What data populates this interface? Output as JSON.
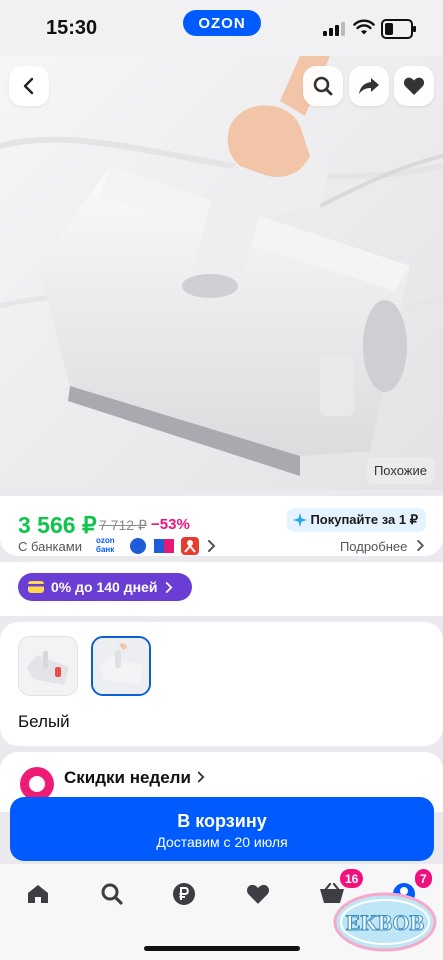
{
  "status_bar": {
    "time": "15:30",
    "logo_text": "OZON"
  },
  "hero": {
    "similar_label": "Похожие",
    "icons": [
      "back-icon",
      "search-icon",
      "share-icon",
      "heart-icon"
    ]
  },
  "price": {
    "current": "3 566 ₽",
    "old": "7 712 ₽",
    "discount": "−53%",
    "buy_for": "Покупайте за 1 ₽",
    "banks_label": "С банками",
    "ozon_bank_top": "ozon",
    "ozon_bank_bottom": "банк",
    "more": "Подробнее"
  },
  "installment": {
    "label": "0% до 140 дней"
  },
  "variants": {
    "color_label": "Белый",
    "selected_index": 1
  },
  "deals": {
    "title": "Скидки недели"
  },
  "cart": {
    "label": "В корзину",
    "delivery": "Доставим с 20 июля"
  },
  "tabbar": {
    "cart_badge": "16",
    "profile_badge": "7",
    "tabs": [
      "home-icon",
      "search-icon",
      "ruble-icon",
      "heart-icon",
      "cart-icon",
      "profile-icon"
    ]
  },
  "watermark": {
    "text": "EKBOB"
  },
  "colors": {
    "brand_blue": "#005bff",
    "price_green": "#10c44c",
    "discount_pink": "#f1117e",
    "installment_purple": "#6a3ed4"
  }
}
